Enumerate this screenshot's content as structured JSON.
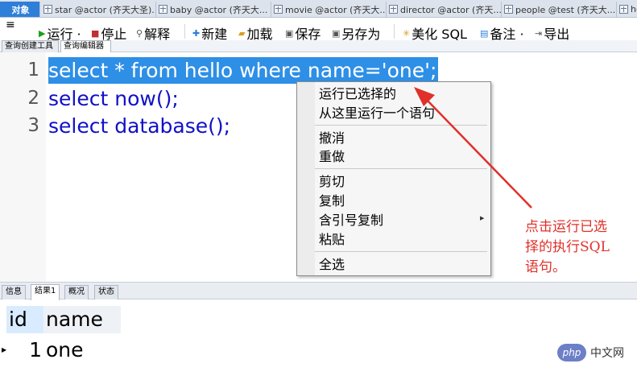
{
  "tabs": [
    {
      "label": "对象",
      "active": true
    },
    {
      "label": "star @actor (齐天大圣)...",
      "active": false
    },
    {
      "label": "baby @actor (齐天大...",
      "active": false
    },
    {
      "label": "movie @actor (齐天大...",
      "active": false
    },
    {
      "label": "director @actor (齐天...",
      "active": false
    },
    {
      "label": "people @test (齐天大...",
      "active": false
    },
    {
      "label": "he",
      "active": false
    }
  ],
  "toolbar": {
    "menu_icon": "menu-icon",
    "run": "运行 ·",
    "stop": "停止",
    "explain": "解释",
    "new": "新建",
    "load": "加载",
    "save": "保存",
    "save_as": "另存为",
    "beautify": "美化 SQL",
    "comment": "备注 ·",
    "export": "导出"
  },
  "editor_tabs": [
    "查询创建工具",
    "查询编辑器"
  ],
  "editor": {
    "lines": [
      {
        "no": "1",
        "text": "select * from hello where name='one';",
        "selected": true
      },
      {
        "no": "2",
        "text": "select now();",
        "selected": false
      },
      {
        "no": "3",
        "text": "select database();",
        "selected": false
      }
    ]
  },
  "context_menu": {
    "run_selected": "运行已选择的",
    "run_from_here": "从这里运行一个语句",
    "undo": "撤消",
    "redo": "重做",
    "cut": "剪切",
    "copy": "复制",
    "copy_quoted": "含引号复制",
    "paste": "粘贴",
    "select_all": "全选"
  },
  "annotation": {
    "lines": [
      "点击运行已选",
      "择的执行SQL",
      "语句。"
    ],
    "color": "#e0302a"
  },
  "result_tabs": [
    "信息",
    "结果1",
    "概况",
    "状态"
  ],
  "results": {
    "columns": [
      "id",
      "name"
    ],
    "rows": [
      [
        "1",
        "one"
      ]
    ]
  },
  "watermark": {
    "logo": "php",
    "text": "中文网"
  },
  "colors": {
    "selection": "#2e8fe6",
    "keyword": "#1010c8",
    "active_tab": "#2e7fd8"
  }
}
